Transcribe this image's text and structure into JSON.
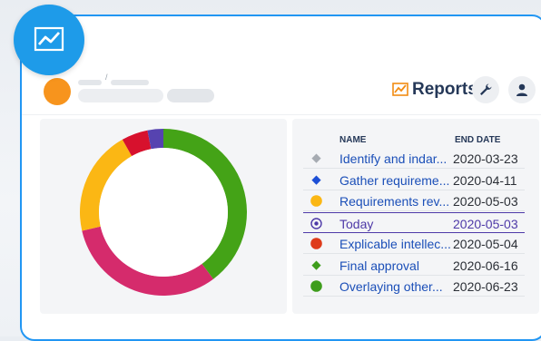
{
  "header": {
    "title": "Reports",
    "breadcrumb_sep": "/"
  },
  "table": {
    "columns": [
      "NAME",
      "END DATE"
    ],
    "rows": [
      {
        "name": "Identify and indar...",
        "date": "2020-03-23",
        "marker": "diamond",
        "color": "#a6abb2"
      },
      {
        "name": "Gather requireme...",
        "date": "2020-04-11",
        "marker": "diamond",
        "color": "#1d4fd6"
      },
      {
        "name": "Requirements rev...",
        "date": "2020-05-03",
        "marker": "circle",
        "color": "#fbb714"
      },
      {
        "name": "Today",
        "date": "2020-05-03",
        "marker": "target",
        "color": "#4e3aa8"
      },
      {
        "name": "Explicable intellec...",
        "date": "2020-05-04",
        "marker": "circle",
        "color": "#de3b1b"
      },
      {
        "name": "Final approval",
        "date": "2020-06-16",
        "marker": "diamond",
        "color": "#3e9d1c"
      },
      {
        "name": "Overlaying other...",
        "date": "2020-06-23",
        "marker": "circle",
        "color": "#3e9d1c"
      }
    ]
  },
  "chart_data": {
    "type": "pie",
    "values": [
      39,
      31,
      20,
      5,
      3
    ],
    "colors": [
      "#44a317",
      "#d52b6c",
      "#fbb714",
      "#d7112d",
      "#5643b0"
    ],
    "title": "",
    "donut": true
  }
}
